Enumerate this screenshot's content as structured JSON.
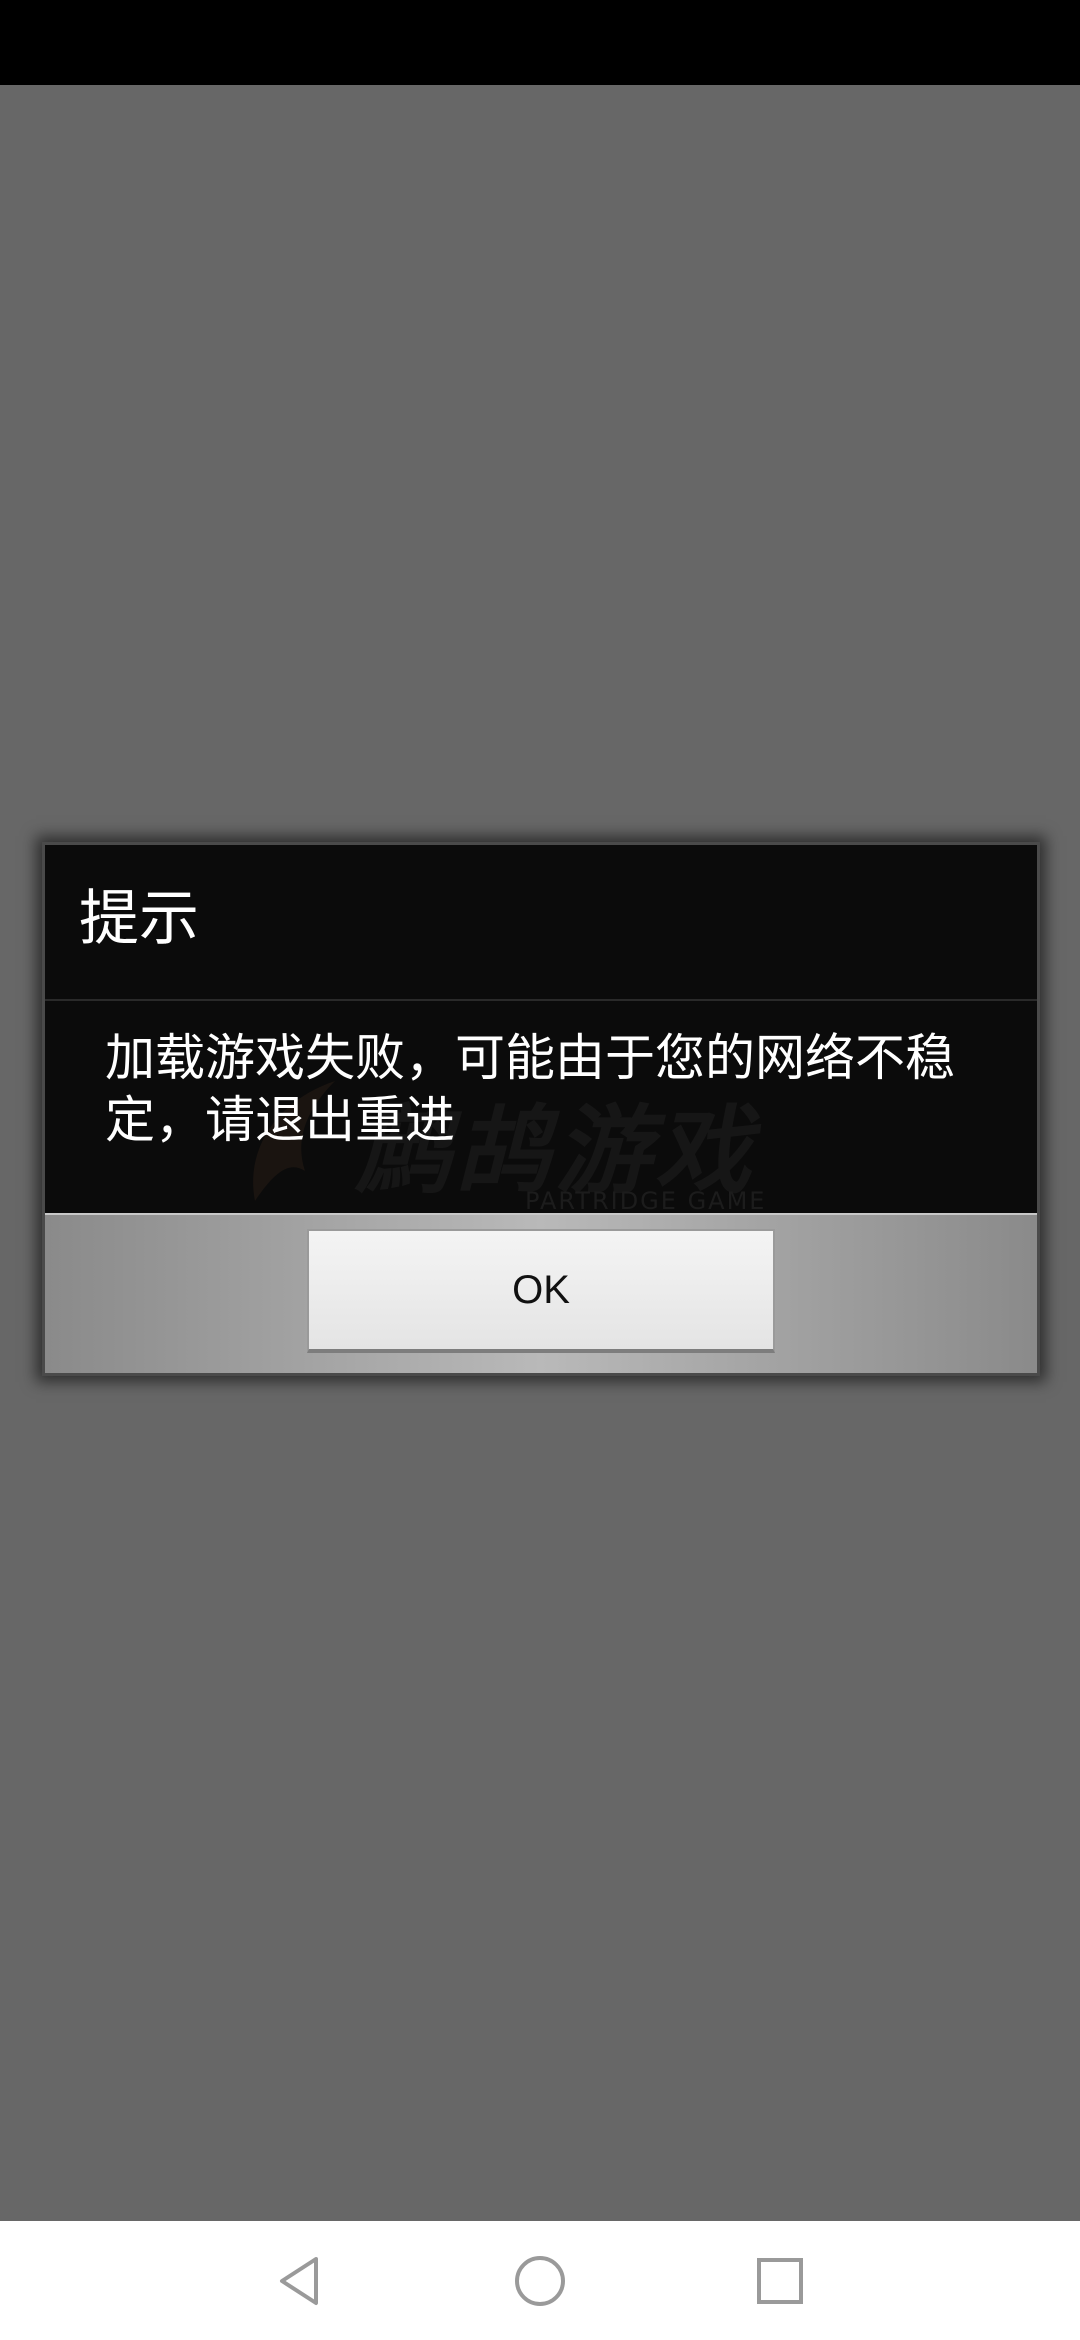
{
  "dialog": {
    "title": "提示",
    "message": "加载游戏失败，可能由于您的网络不稳定，请退出重进",
    "ok_label": "OK"
  },
  "watermark": {
    "logo_text": "鹧鸪游戏",
    "logo_subtext": "PARTRIDGE GAME"
  },
  "navigation": {
    "back_icon": "back-triangle-icon",
    "home_icon": "home-circle-icon",
    "recent_icon": "recent-apps-square-icon"
  },
  "colors": {
    "backdrop": "#676767",
    "dialog_background": "#0b0b0b",
    "status_bar": "#000000",
    "nav_bar": "#ffffff"
  }
}
